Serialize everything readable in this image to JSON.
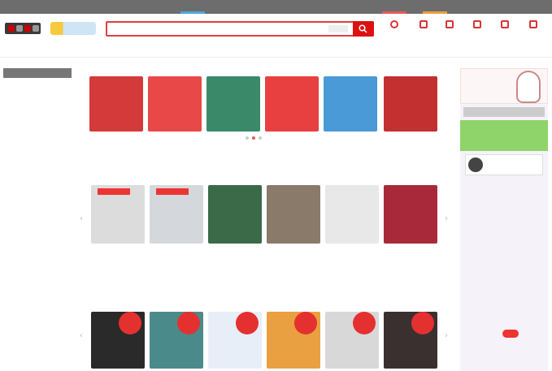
{
  "top_strip": {
    "accent_colors": [
      "#4aa8d8",
      "#e85a5a",
      "#e8a040"
    ]
  },
  "header": {
    "search": {
      "placeholder": "",
      "scope_label": "",
      "button_icon": "search-icon"
    },
    "icons": [
      {
        "name": "person-icon",
        "label": ""
      },
      {
        "name": "heart-icon",
        "label": ""
      },
      {
        "name": "mail-icon",
        "label": ""
      },
      {
        "name": "gift-icon",
        "label": ""
      },
      {
        "name": "bell-icon",
        "label": ""
      },
      {
        "name": "cart-icon",
        "label": ""
      }
    ]
  },
  "nav": {
    "items": [
      "",
      "",
      "",
      "",
      "",
      "",
      "",
      "",
      "",
      "",
      ""
    ]
  },
  "sidebar": {
    "heading": "",
    "items": [
      "",
      "",
      "",
      "",
      "",
      "",
      "",
      "",
      "",
      "",
      "",
      "",
      "",
      "",
      "",
      "",
      "",
      "",
      "",
      "",
      "",
      ""
    ]
  },
  "banners": [
    {
      "text": "",
      "bg": "#d43a3a"
    },
    {
      "text": "",
      "bg": "#e84848"
    },
    {
      "text": "",
      "bg": "#3a8a6a"
    },
    {
      "text": "",
      "bg": "#e84040"
    },
    {
      "text": "",
      "bg": "#4a9ad8"
    },
    {
      "text": "",
      "bg": "#c23030"
    }
  ],
  "section1": {
    "title": "",
    "more": "",
    "products": [
      {
        "name": "",
        "price": "",
        "bg": "#dcdcdc",
        "tag": true
      },
      {
        "name": "",
        "price": "",
        "bg": "#d4d8dc",
        "tag": true
      },
      {
        "name": "",
        "price": "",
        "bg": "#3a6a48",
        "tag": false
      },
      {
        "name": "",
        "price": "",
        "bg": "#8a7a6a",
        "tag": false
      },
      {
        "name": "",
        "price": "",
        "bg": "#e8e8e8",
        "tag": false
      },
      {
        "name": "",
        "price": "",
        "bg": "#a82a3a",
        "tag": false
      }
    ]
  },
  "section2": {
    "title": "",
    "more": "",
    "products": [
      {
        "bg": "#2a2a2a",
        "rank": ""
      },
      {
        "bg": "#4a8a8a",
        "rank": ""
      },
      {
        "bg": "#e8eef8",
        "rank": ""
      },
      {
        "bg": "#e8a040",
        "rank": ""
      },
      {
        "bg": "#d8d8d8",
        "rank": ""
      },
      {
        "bg": "#3a3030",
        "rank": ""
      }
    ]
  },
  "right_panel": {
    "promo_text": "",
    "mid_label": "",
    "green_button": "",
    "items": [
      "",
      "",
      "",
      "",
      "",
      "",
      "",
      "",
      "",
      ""
    ]
  }
}
